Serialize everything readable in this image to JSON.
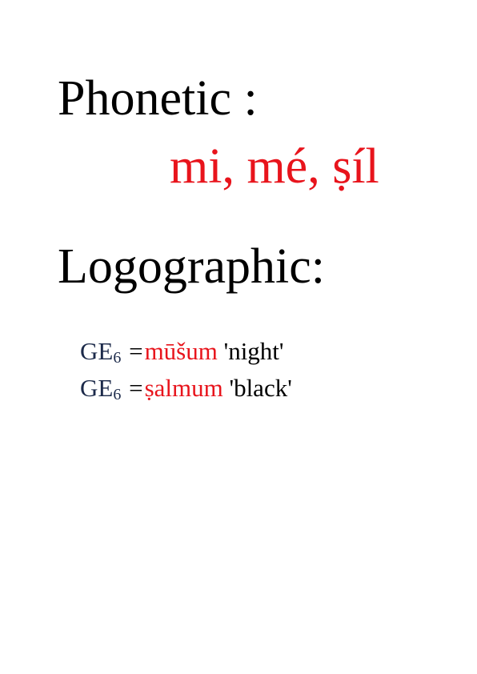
{
  "phonetic": {
    "heading": "Phonetic :",
    "values": "mi, mé, ṣíl"
  },
  "logographic": {
    "heading": "Logographic:",
    "rows": [
      {
        "sign": "GE",
        "subscript": "6",
        "equals": "=",
        "reading": "mūšum",
        "gloss": "'night'"
      },
      {
        "sign": "GE",
        "subscript": "6",
        "equals": "=",
        "reading": "ṣalmum",
        "gloss": "'black'"
      }
    ]
  },
  "colors": {
    "reading": "#e8141c",
    "sign": "#1c2a4a",
    "text": "#000000"
  }
}
